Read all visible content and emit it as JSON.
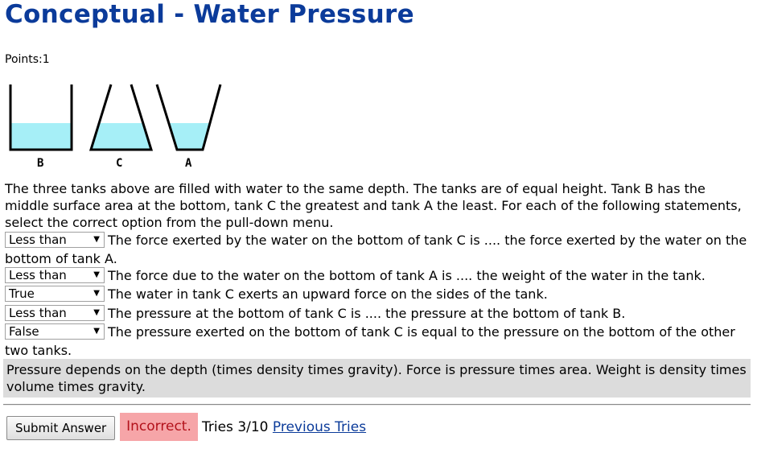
{
  "title": "Conceptual - Water Pressure",
  "points_label": "Points:",
  "points_value": "1",
  "tanks": {
    "labels": [
      "B",
      "C",
      "A"
    ],
    "water_color": "#a6eff7"
  },
  "intro": "The three tanks above are filled with water to the same depth. The tanks are of equal height. Tank B has the middle surface area at the bottom, tank C the greatest and tank A the least. For each of the following statements, select the correct option from the pull-down menu.",
  "questions": [
    {
      "selected": "Less than",
      "text": "The force exerted by the water on the bottom of tank C is .... the force exerted by the water on the bottom of tank A."
    },
    {
      "selected": "Less than",
      "text": "The force due to the water on the bottom of tank A is .... the weight of the water in the tank."
    },
    {
      "selected": "True",
      "text": "The water in tank C exerts an upward force on the sides of the tank."
    },
    {
      "selected": "Less than",
      "text": "The pressure at the bottom of tank C is .... the pressure at the bottom of tank B."
    },
    {
      "selected": "False",
      "text": "The pressure exerted on the bottom of tank C is equal to the pressure on the bottom of the other two tanks."
    }
  ],
  "hint": "Pressure depends on the depth (times density times gravity). Force is pressure times area. Weight is density times volume times gravity.",
  "submit_label": "Submit Answer",
  "status": "Incorrect.",
  "tries_text": "Tries 3/10",
  "previous_tries_label": "Previous Tries",
  "colors": {
    "title": "#0b3b9a",
    "incorrect_bg": "#f6a5a8",
    "incorrect_text": "#b3121b",
    "hint_bg": "#dcdcdc"
  }
}
